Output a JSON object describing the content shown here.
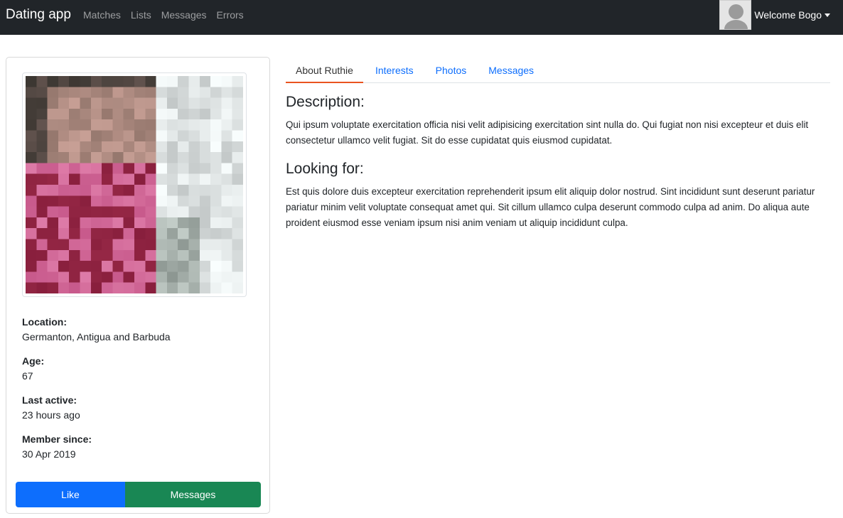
{
  "navbar": {
    "brand": "Dating app",
    "links": [
      "Matches",
      "Lists",
      "Messages",
      "Errors"
    ],
    "welcome": "Welcome Bogo"
  },
  "profile": {
    "location_label": "Location:",
    "location": "Germanton, Antigua and Barbuda",
    "age_label": "Age:",
    "age": "67",
    "last_active_label": "Last active:",
    "last_active": "23 hours ago",
    "member_since_label": "Member since:",
    "member_since": "30 Apr 2019",
    "like_button": "Like",
    "messages_button": "Messages"
  },
  "tabs": [
    "About Ruthie",
    "Interests",
    "Photos",
    "Messages"
  ],
  "about": {
    "description_heading": "Description:",
    "description": "Qui ipsum voluptate exercitation officia nisi velit adipisicing exercitation sint nulla do. Qui fugiat non nisi excepteur et duis elit consectetur ullamco velit fugiat. Sit do esse cupidatat quis eiusmod cupidatat.",
    "looking_for_heading": "Looking for:",
    "looking_for": "Est quis dolore duis excepteur exercitation reprehenderit ipsum elit aliquip dolor nostrud. Sint incididunt sunt deserunt pariatur pariatur minim velit voluptate consequat amet qui. Sit cillum ullamco culpa deserunt commodo culpa ad anim. Do aliqua aute proident eiusmod esse veniam ipsum nisi anim veniam ut aliquip incididunt culpa."
  },
  "colors": {
    "navbar_bg": "#212529",
    "primary": "#0d6efd",
    "success": "#198754",
    "tab_active_border": "#e95420"
  },
  "icons": {
    "user_avatar": "user-silhouette-icon",
    "dropdown": "caret-down-icon"
  }
}
